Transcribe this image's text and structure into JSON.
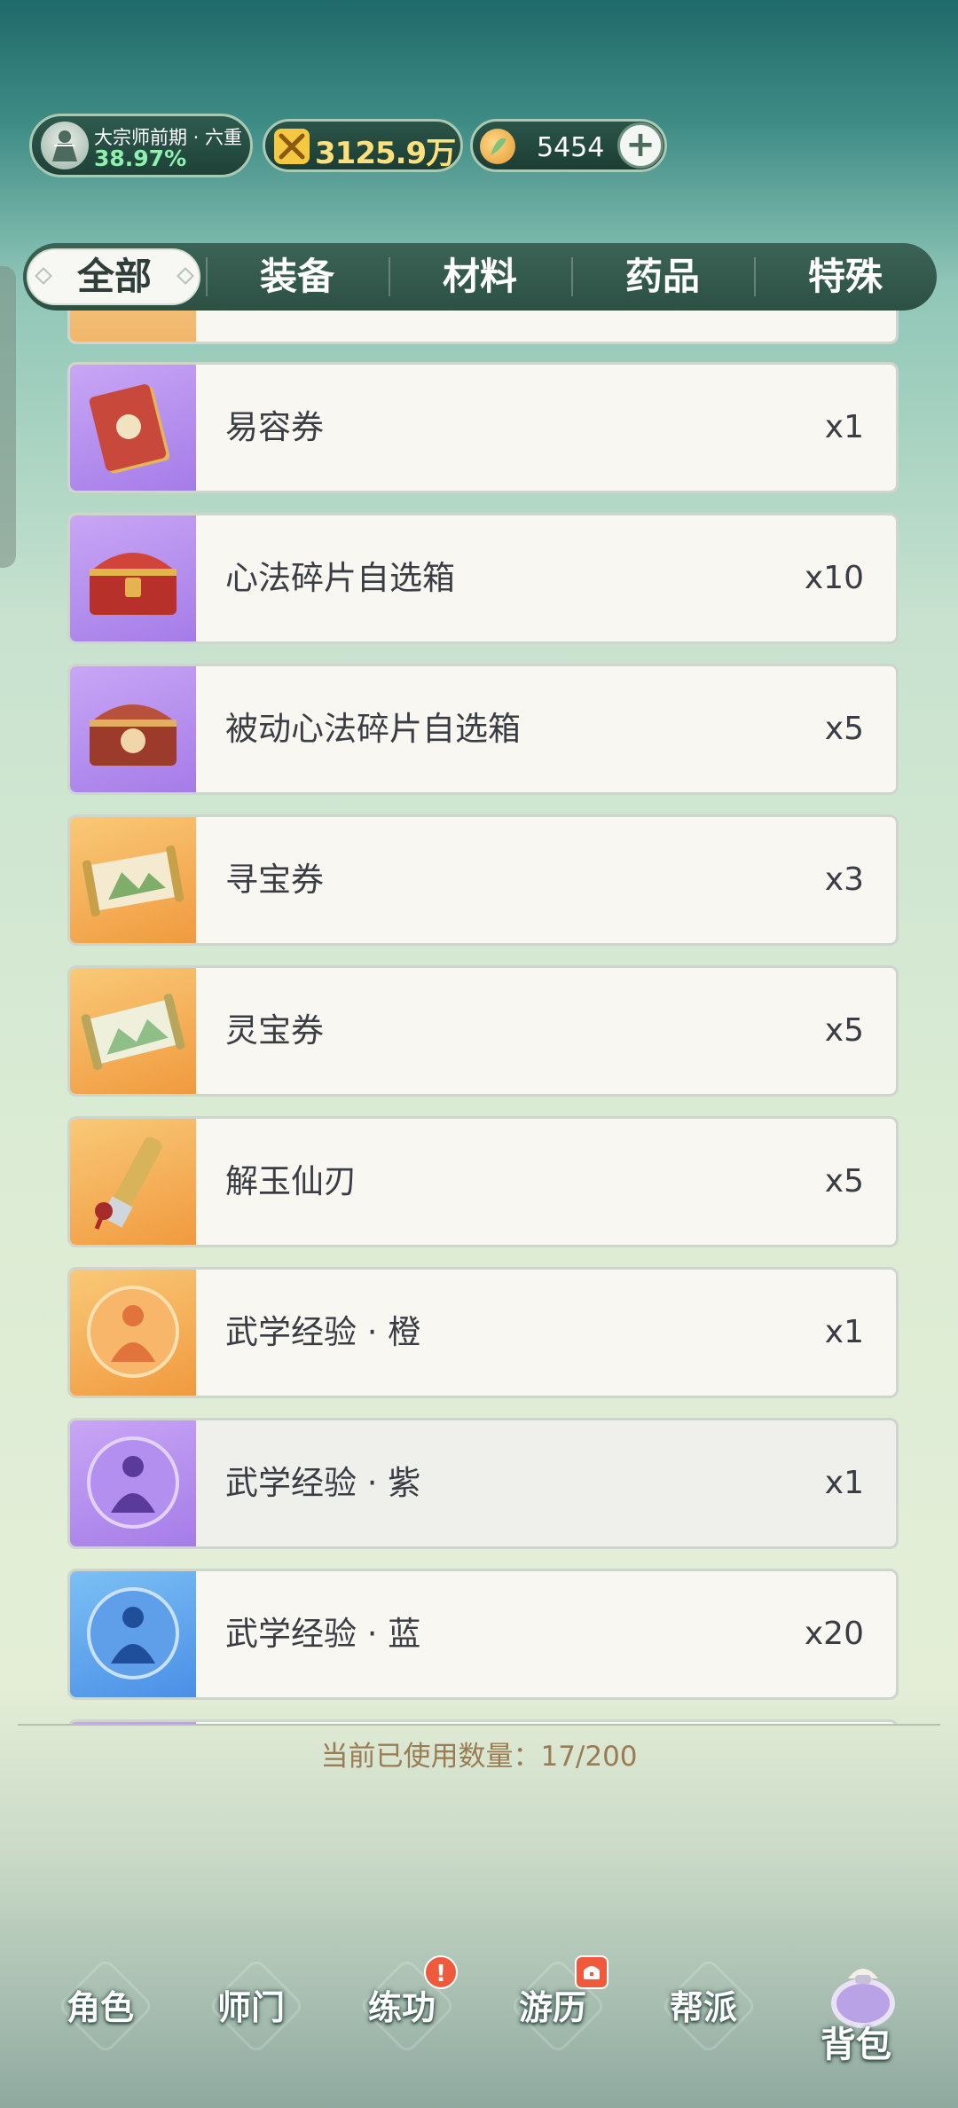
{
  "status": {
    "rank_name": "大宗师前期 · 六重",
    "rank_progress": "38.97%",
    "combat_power": "3125.9万",
    "currency": "5454",
    "add_label": "+"
  },
  "tabs": [
    {
      "label": "全部",
      "active": true
    },
    {
      "label": "装备",
      "active": false
    },
    {
      "label": "材料",
      "active": false
    },
    {
      "label": "药品",
      "active": false
    },
    {
      "label": "特殊",
      "active": false
    }
  ],
  "items": [
    {
      "name": "易容券",
      "qty": "x1",
      "icon": "ticket-icon",
      "rarity": "purple"
    },
    {
      "name": "心法碎片自选箱",
      "qty": "x10",
      "icon": "treasure-chest-icon",
      "rarity": "purple"
    },
    {
      "name": "被动心法碎片自选箱",
      "qty": "x5",
      "icon": "treasure-chest-icon",
      "rarity": "purple"
    },
    {
      "name": "寻宝券",
      "qty": "x3",
      "icon": "scroll-icon",
      "rarity": "orange"
    },
    {
      "name": "灵宝券",
      "qty": "x5",
      "icon": "scroll-icon",
      "rarity": "orange"
    },
    {
      "name": "解玉仙刃",
      "qty": "x5",
      "icon": "chisel-icon",
      "rarity": "orange"
    },
    {
      "name": "武学经验 · 橙",
      "qty": "x1",
      "icon": "exp-orb-icon",
      "rarity": "orange"
    },
    {
      "name": "武学经验 · 紫",
      "qty": "x1",
      "icon": "exp-orb-icon",
      "rarity": "purple"
    },
    {
      "name": "武学经验 · 蓝",
      "qty": "x20",
      "icon": "exp-orb-icon",
      "rarity": "blue"
    }
  ],
  "usage_text": "当前已使用数量：17/200",
  "nav": [
    {
      "label": "角色",
      "badge": ""
    },
    {
      "label": "师门",
      "badge": ""
    },
    {
      "label": "练功",
      "badge": "!"
    },
    {
      "label": "游历",
      "badge": "chest"
    },
    {
      "label": "帮派",
      "badge": ""
    },
    {
      "label": "背包",
      "badge": "",
      "active": true
    }
  ],
  "colors": {
    "purple": "#b48af0",
    "orange": "#f3a64b",
    "blue": "#5aa9ee",
    "accent_text": "#9a7c54"
  }
}
